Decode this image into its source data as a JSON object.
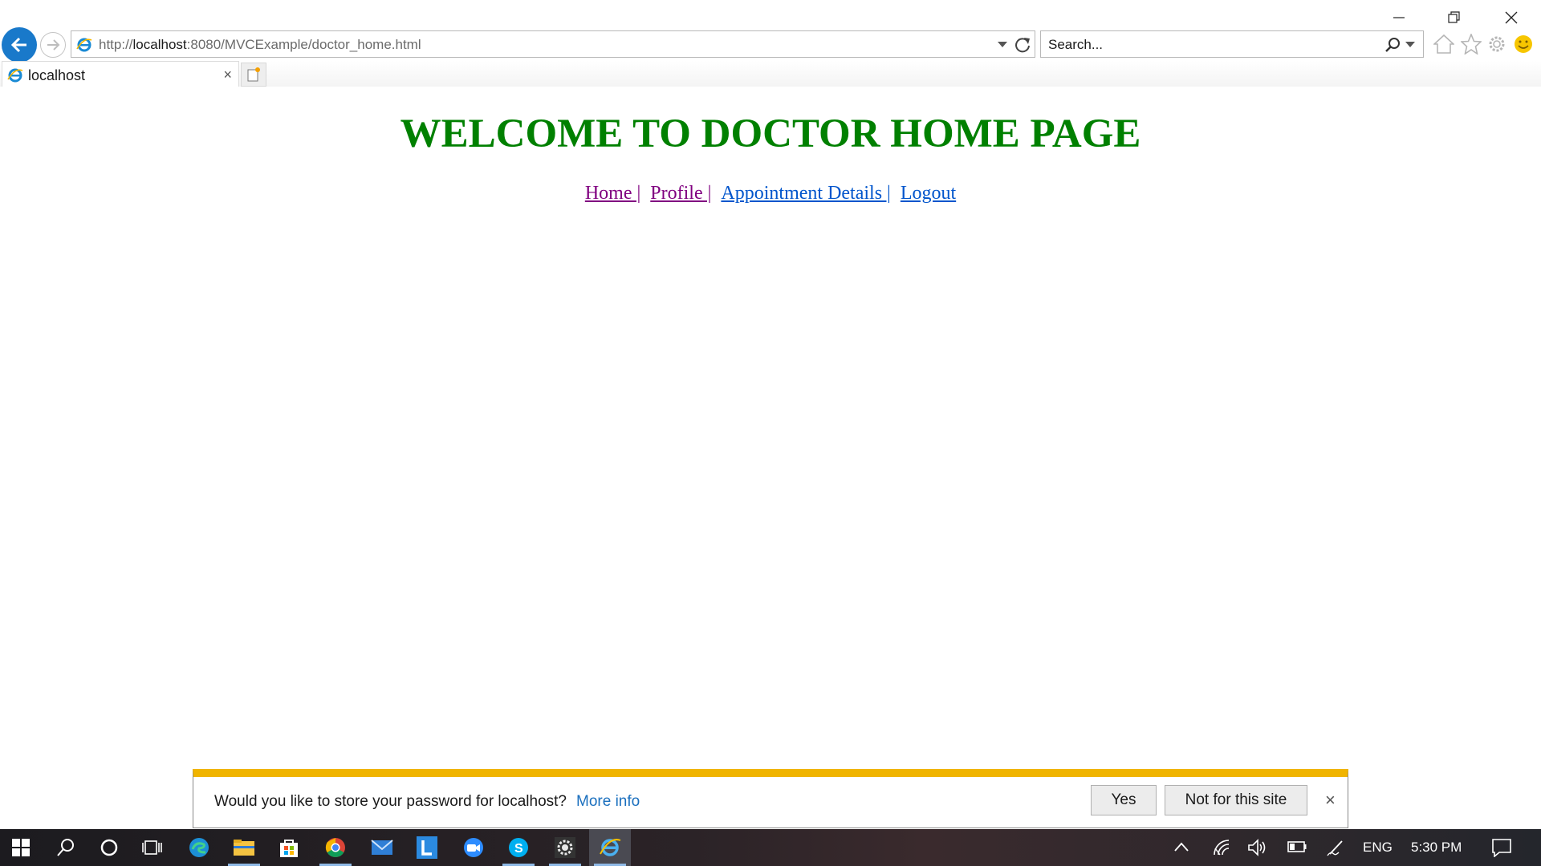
{
  "browser": {
    "url_scheme": "http://",
    "url_host": "localhost",
    "url_path": ":8080/MVCExample/doctor_home.html",
    "search_placeholder": "Search...",
    "tab_label": "localhost",
    "tab_close": "×"
  },
  "page": {
    "title": "WELCOME TO DOCTOR HOME PAGE",
    "nav": [
      {
        "label": "Home |",
        "visited": true
      },
      {
        "label": "Profile |",
        "visited": true
      },
      {
        "label": "Appointment Details |",
        "visited": false
      },
      {
        "label": "Logout",
        "visited": false
      }
    ]
  },
  "notification": {
    "message": "Would you like to store your password for localhost?",
    "more_info": "More info",
    "yes_label": "Yes",
    "not_for_site_label": "Not for this site",
    "close": "×"
  },
  "taskbar": {
    "apps": [
      "start",
      "search",
      "cortana",
      "task-view",
      "edge",
      "file-explorer",
      "store",
      "chrome",
      "mail",
      "l-app",
      "zoom",
      "skype",
      "settings-app",
      "internet-explorer"
    ],
    "language": "ENG",
    "time": "5:30 PM"
  },
  "colors": {
    "title_green": "#008000",
    "visited_link": "#800080",
    "link_blue": "#0055cc",
    "notify_accent": "#f0b400",
    "ie_blue": "#1979ca"
  }
}
